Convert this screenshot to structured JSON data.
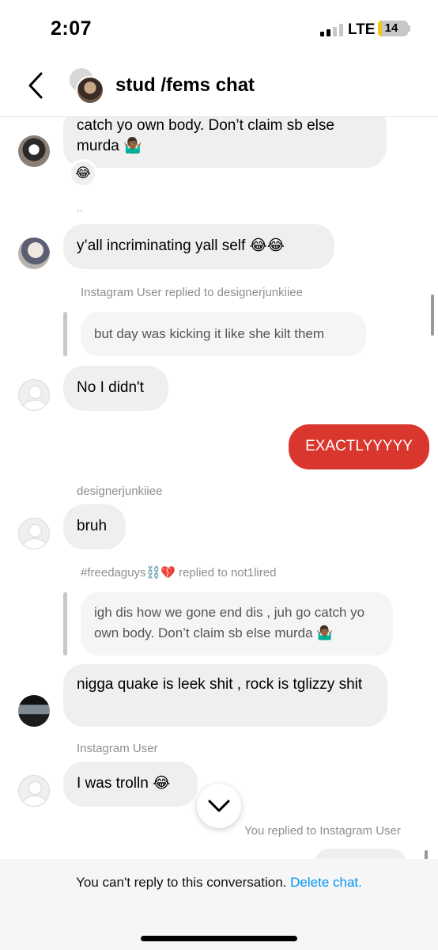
{
  "status_bar": {
    "time": "2:07",
    "network": "LTE",
    "battery": "14",
    "battery_level": 0.14,
    "battery_color": "#f5c518"
  },
  "header": {
    "back_icon": "chevron-left-icon",
    "title": "stud /fems chat"
  },
  "messages": [
    {
      "type": "received",
      "text": "catch yo own body. Don’t claim sb else murda 🤷🏾‍♂️",
      "reaction": "😂"
    },
    {
      "type": "divider",
      "text": ".."
    },
    {
      "type": "received",
      "text": "y’all incriminating yall self 😂😂"
    },
    {
      "type": "reply_meta",
      "text": "Instagram User replied to designerjunkiiee"
    },
    {
      "type": "reply_quote",
      "text": "but day was kicking it like she kilt them"
    },
    {
      "type": "received",
      "text": "No I didn't"
    },
    {
      "type": "sent",
      "text": "EXACTLYYYYY"
    },
    {
      "type": "sender",
      "text": "designerjunkiiee"
    },
    {
      "type": "received",
      "text": "bruh"
    },
    {
      "type": "reply_meta",
      "text": "#freedaguys⛓️💔 replied to not1lired"
    },
    {
      "type": "reply_quote",
      "text": "igh dis how we gone end dis , juh go catch yo own body. Don’t claim sb else murda 🤷🏾‍♂️"
    },
    {
      "type": "received",
      "text": "nigga quake is leek shit , rock is tglizzy shit"
    },
    {
      "type": "sender",
      "text": "Instagram User"
    },
    {
      "type": "received",
      "text": "I was trolln 😂"
    },
    {
      "type": "reply_meta",
      "text": "You replied to Instagram User"
    }
  ],
  "scroll_down_icon": "chevron-down-icon",
  "footer": {
    "notice": "You can't reply to this conversation.",
    "link": "Delete chat.",
    "link_color": "#0095f6"
  },
  "colors": {
    "sent_bubble": "#d9362e",
    "received_bubble": "#efefef"
  }
}
